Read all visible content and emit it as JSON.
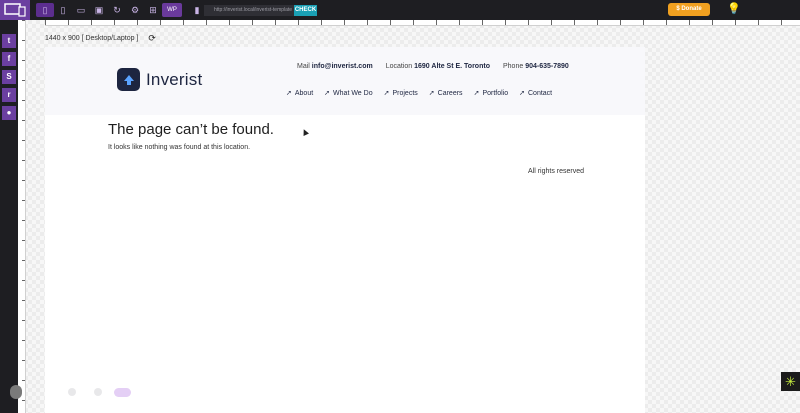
{
  "toolbar": {
    "wp_label": "WP",
    "url": "http://inverist.local/inverist-template",
    "check_label": "CHECK",
    "donate_label": "$ Donate"
  },
  "icons": {
    "logo": "responsive-devices-icon",
    "twitter": "twitter-icon",
    "facebook": "facebook-icon",
    "skype": "skype-icon",
    "reddit": "reddit-icon",
    "user": "user-icon",
    "bulb": "lightbulb-icon",
    "widget": "asterisk-icon"
  },
  "viewport": {
    "label": "1440 x 900 [ Desktop/Laptop ]"
  },
  "site": {
    "brand_name": "Inverist",
    "contact": {
      "mail_label": "Mail",
      "mail_value": "info@inverist.com",
      "location_label": "Location",
      "location_value": "1690 Alte St E. Toronto",
      "phone_label": "Phone",
      "phone_value": "904-635-7890"
    },
    "nav": [
      "About",
      "What We Do",
      "Projects",
      "Careers",
      "Portfolio",
      "Contact"
    ],
    "error_title": "The page can’t be found.",
    "error_message": "It looks like nothing was found at this location.",
    "footer": "All rights reserved"
  },
  "colors": {
    "accent": "#6b3fa0",
    "brand": "#1d2540",
    "donate": "#f0a020",
    "check": "#1aa0b5"
  }
}
